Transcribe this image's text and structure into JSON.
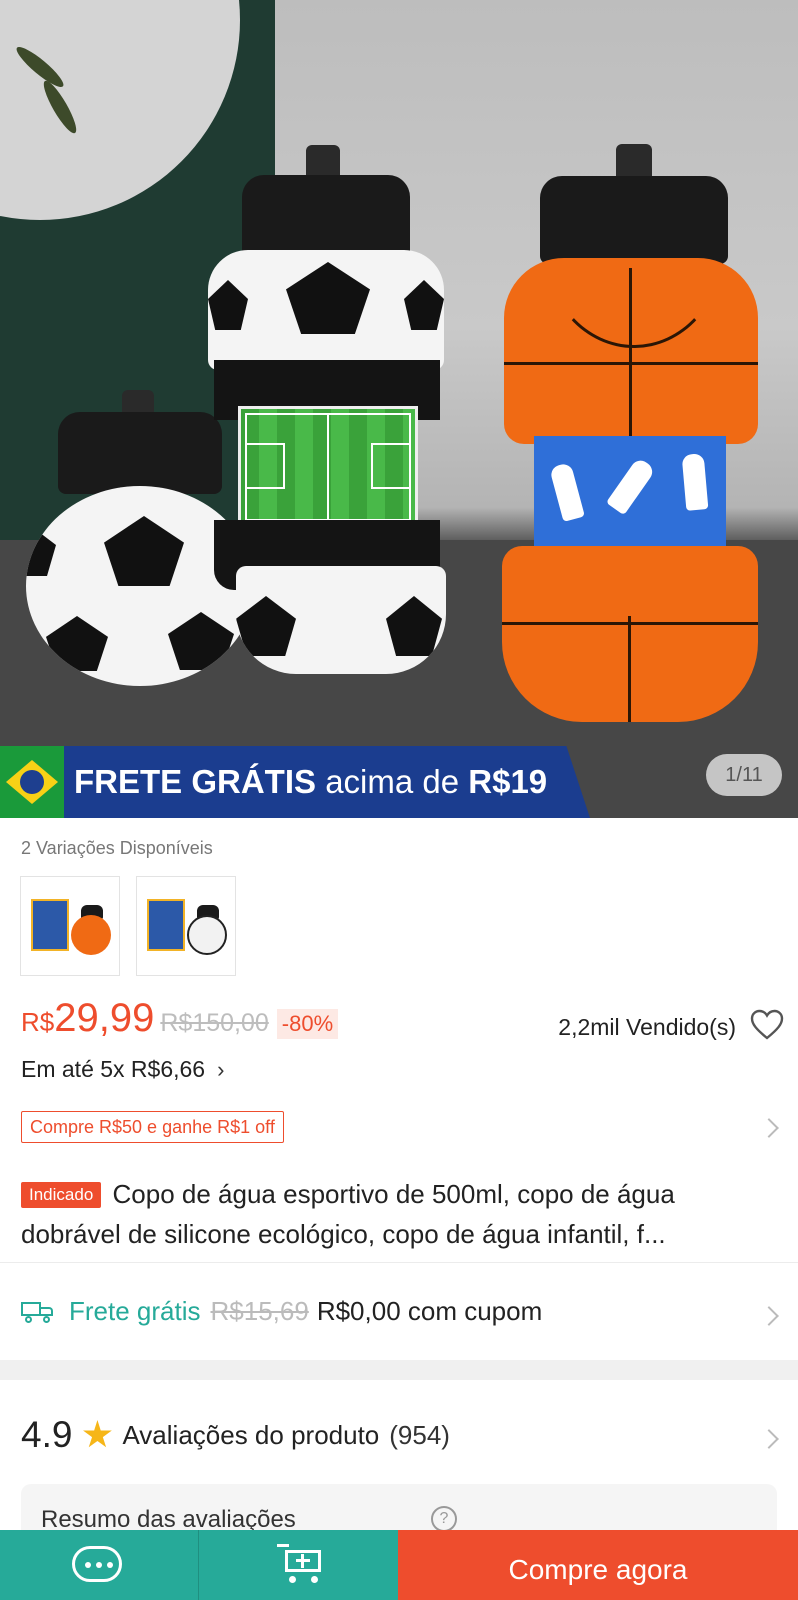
{
  "gallery": {
    "banner_prefix": "FRETE GRÁTIS",
    "banner_mid": "acima de",
    "banner_amount": "R$19",
    "counter": "1/11"
  },
  "variations": {
    "label": "2 Variações Disponíveis",
    "items": [
      {
        "name": "basketball-variant",
        "color": "#f06a14"
      },
      {
        "name": "football-variant",
        "color": "#f2f2f2"
      }
    ]
  },
  "price": {
    "currency": "R$",
    "current": "29,99",
    "original": "R$150,00",
    "discount": "-80%",
    "sold": "2,2mil Vendido(s)",
    "installments": "Em até 5x R$6,66"
  },
  "coupon": {
    "text": "Compre R$50 e ganhe R$1 off"
  },
  "product": {
    "tag": "Indicado",
    "title": "Copo de água esportivo de 500ml, copo de água dobrável de silicone ecológico, copo de água infantil, f..."
  },
  "shipping": {
    "free_label": "Frete grátis",
    "old_price": "R$15,69",
    "new_price": "R$0,00 com cupom"
  },
  "reviews": {
    "score": "4.9",
    "label": "Avaliações do produto",
    "count": "(954)",
    "summary_title": "Resumo das avaliações",
    "help": "?"
  },
  "bottom_bar": {
    "buy_label": "Compre agora"
  },
  "colors": {
    "accent": "#ee4d2d",
    "teal": "#26aa99",
    "star": "#f6b618"
  }
}
